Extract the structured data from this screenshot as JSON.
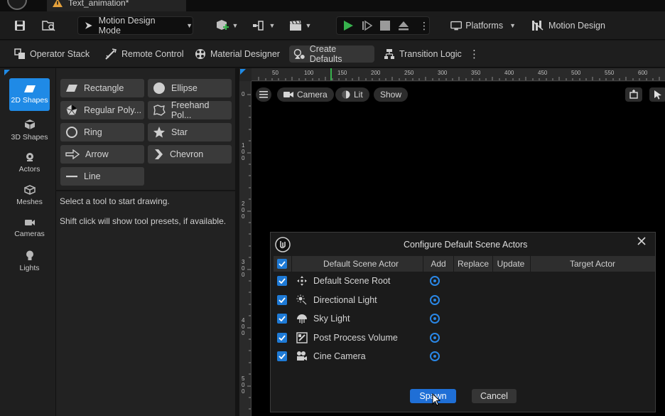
{
  "tab": {
    "title": "Text_animation*"
  },
  "toolbar": {
    "mode_label": "Motion Design Mode",
    "platforms_label": "Platforms",
    "motion_design_label": "Motion Design"
  },
  "secondary_toolbar": {
    "items": [
      {
        "label": "Operator Stack",
        "icon": "operator-stack-icon"
      },
      {
        "label": "Remote Control",
        "icon": "remote-control-icon"
      },
      {
        "label": "Material Designer",
        "icon": "material-designer-icon"
      },
      {
        "label": "Create Defaults",
        "icon": "create-defaults-icon",
        "active": true
      },
      {
        "label": "Transition Logic",
        "icon": "transition-logic-icon"
      }
    ]
  },
  "modes": [
    {
      "label": "2D Shapes",
      "active": true
    },
    {
      "label": "3D Shapes"
    },
    {
      "label": "Actors"
    },
    {
      "label": "Meshes"
    },
    {
      "label": "Cameras"
    },
    {
      "label": "Lights"
    }
  ],
  "tools": [
    {
      "label": "Rectangle",
      "icon": "rectangle-icon"
    },
    {
      "label": "Ellipse",
      "icon": "ellipse-icon"
    },
    {
      "label": "Regular Poly...",
      "icon": "polygon-icon"
    },
    {
      "label": "Freehand Pol...",
      "icon": "freehand-icon"
    },
    {
      "label": "Ring",
      "icon": "ring-icon"
    },
    {
      "label": "Star",
      "icon": "star-icon"
    },
    {
      "label": "Arrow",
      "icon": "arrow-icon"
    },
    {
      "label": "Chevron",
      "icon": "chevron-icon"
    },
    {
      "label": "Line",
      "icon": "line-icon"
    }
  ],
  "hints": {
    "line1": "Select a tool to start drawing.",
    "line2": "Shift click will show tool presets, if available."
  },
  "ruler": {
    "top_ticks": [
      "50",
      "100",
      "150",
      "200",
      "250",
      "300",
      "350",
      "400",
      "450",
      "500",
      "550",
      "600"
    ],
    "left_ticks": [
      [
        "0"
      ],
      [
        "1",
        "0",
        "0"
      ],
      [
        "2",
        "0",
        "0"
      ],
      [
        "3",
        "0",
        "0"
      ],
      [
        "4",
        "0",
        "0"
      ],
      [
        "5",
        "0",
        "0"
      ]
    ]
  },
  "viewport": {
    "camera_label": "Camera",
    "lit_label": "Lit",
    "show_label": "Show"
  },
  "dialog": {
    "title": "Configure Default Scene Actors",
    "columns": {
      "actor": "Default Scene Actor",
      "add": "Add",
      "replace": "Replace",
      "update": "Update",
      "target": "Target Actor"
    },
    "rows": [
      {
        "label": "Default Scene Root",
        "icon": "scene-root-icon",
        "checked": true,
        "add": true
      },
      {
        "label": "Directional Light",
        "icon": "directional-light-icon",
        "checked": true,
        "add": true
      },
      {
        "label": "Sky Light",
        "icon": "sky-light-icon",
        "checked": true,
        "add": true
      },
      {
        "label": "Post Process Volume",
        "icon": "post-process-icon",
        "checked": true,
        "add": true
      },
      {
        "label": "Cine Camera",
        "icon": "cine-camera-icon",
        "checked": true,
        "add": true
      }
    ],
    "spawn_label": "Spawn",
    "cancel_label": "Cancel"
  },
  "colors": {
    "accent": "#1f8ae6",
    "play": "#37b24d"
  }
}
